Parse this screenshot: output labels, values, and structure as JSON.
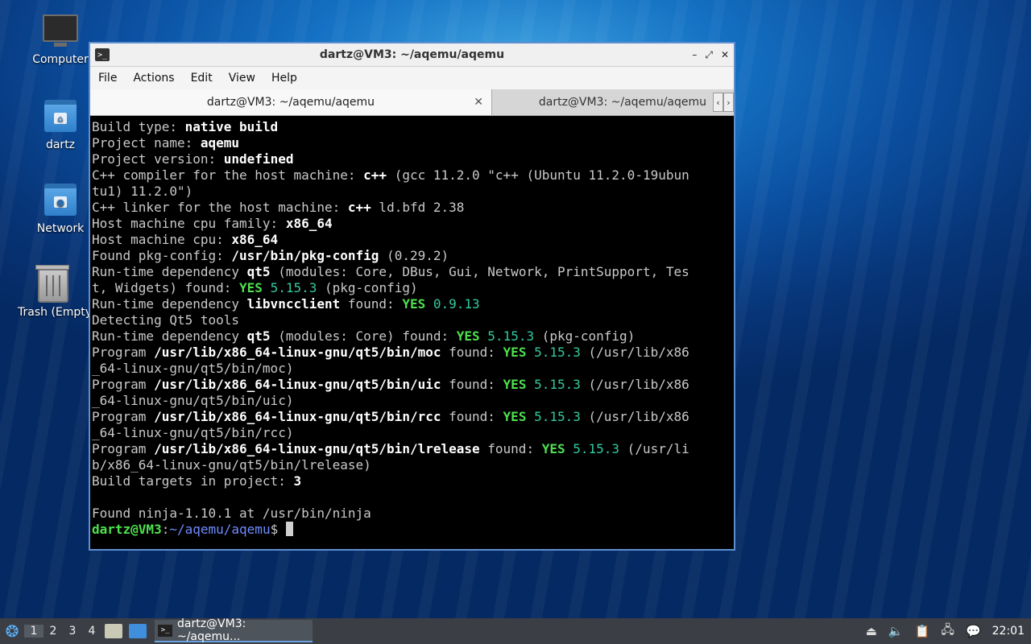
{
  "desktop": {
    "icons": [
      {
        "label": "Computer"
      },
      {
        "label": "dartz"
      },
      {
        "label": "Network"
      },
      {
        "label": "Trash (Empty)"
      }
    ]
  },
  "window": {
    "title": "dartz@VM3: ~/aqemu/aqemu",
    "menu": [
      "File",
      "Actions",
      "Edit",
      "View",
      "Help"
    ],
    "tabs": [
      {
        "label": "dartz@VM3: ~/aqemu/aqemu",
        "active": true
      },
      {
        "label": "dartz@VM3: ~/aqemu/aqemu",
        "active": false
      }
    ],
    "controls": {
      "minimize": "–",
      "maximize": "⤢",
      "close": "✕"
    }
  },
  "terminal": {
    "lines": [
      [
        {
          "t": "Build type: "
        },
        {
          "t": "native build",
          "c": "b"
        }
      ],
      [
        {
          "t": "Project name: "
        },
        {
          "t": "aqemu",
          "c": "b"
        }
      ],
      [
        {
          "t": "Project version: "
        },
        {
          "t": "undefined",
          "c": "b"
        }
      ],
      [
        {
          "t": "C++ compiler for the host machine: "
        },
        {
          "t": "c++",
          "c": "b"
        },
        {
          "t": " (gcc 11.2.0 \"c++ (Ubuntu 11.2.0-19ubun"
        }
      ],
      [
        {
          "t": "tu1) 11.2.0\")"
        }
      ],
      [
        {
          "t": "C++ linker for the host machine: "
        },
        {
          "t": "c++",
          "c": "b"
        },
        {
          "t": " ld.bfd 2.38"
        }
      ],
      [
        {
          "t": "Host machine cpu family: "
        },
        {
          "t": "x86_64",
          "c": "b"
        }
      ],
      [
        {
          "t": "Host machine cpu: "
        },
        {
          "t": "x86_64",
          "c": "b"
        }
      ],
      [
        {
          "t": "Found pkg-config: "
        },
        {
          "t": "/usr/bin/pkg-config",
          "c": "b"
        },
        {
          "t": " (0.29.2)"
        }
      ],
      [
        {
          "t": "Run-time dependency "
        },
        {
          "t": "qt5",
          "c": "b"
        },
        {
          "t": " (modules: Core, DBus, Gui, Network, PrintSupport, Tes"
        }
      ],
      [
        {
          "t": "t, Widgets) found: "
        },
        {
          "t": "YES",
          "c": "g"
        },
        {
          "t": " "
        },
        {
          "t": "5.15.3",
          "c": "v"
        },
        {
          "t": " (pkg-config)"
        }
      ],
      [
        {
          "t": "Run-time dependency "
        },
        {
          "t": "libvncclient",
          "c": "b"
        },
        {
          "t": " found: "
        },
        {
          "t": "YES",
          "c": "g"
        },
        {
          "t": " "
        },
        {
          "t": "0.9.13",
          "c": "v"
        }
      ],
      [
        {
          "t": "Detecting Qt5 tools"
        }
      ],
      [
        {
          "t": "Run-time dependency "
        },
        {
          "t": "qt5",
          "c": "b"
        },
        {
          "t": " (modules: Core) found: "
        },
        {
          "t": "YES",
          "c": "g"
        },
        {
          "t": " "
        },
        {
          "t": "5.15.3",
          "c": "v"
        },
        {
          "t": " (pkg-config)"
        }
      ],
      [
        {
          "t": "Program "
        },
        {
          "t": "/usr/lib/x86_64-linux-gnu/qt5/bin/moc",
          "c": "b"
        },
        {
          "t": " found: "
        },
        {
          "t": "YES",
          "c": "g"
        },
        {
          "t": " "
        },
        {
          "t": "5.15.3",
          "c": "v"
        },
        {
          "t": " (/usr/lib/x86"
        }
      ],
      [
        {
          "t": "_64-linux-gnu/qt5/bin/moc)"
        }
      ],
      [
        {
          "t": "Program "
        },
        {
          "t": "/usr/lib/x86_64-linux-gnu/qt5/bin/uic",
          "c": "b"
        },
        {
          "t": " found: "
        },
        {
          "t": "YES",
          "c": "g"
        },
        {
          "t": " "
        },
        {
          "t": "5.15.3",
          "c": "v"
        },
        {
          "t": " (/usr/lib/x86"
        }
      ],
      [
        {
          "t": "_64-linux-gnu/qt5/bin/uic)"
        }
      ],
      [
        {
          "t": "Program "
        },
        {
          "t": "/usr/lib/x86_64-linux-gnu/qt5/bin/rcc",
          "c": "b"
        },
        {
          "t": " found: "
        },
        {
          "t": "YES",
          "c": "g"
        },
        {
          "t": " "
        },
        {
          "t": "5.15.3",
          "c": "v"
        },
        {
          "t": " (/usr/lib/x86"
        }
      ],
      [
        {
          "t": "_64-linux-gnu/qt5/bin/rcc)"
        }
      ],
      [
        {
          "t": "Program "
        },
        {
          "t": "/usr/lib/x86_64-linux-gnu/qt5/bin/lrelease",
          "c": "b"
        },
        {
          "t": " found: "
        },
        {
          "t": "YES",
          "c": "g"
        },
        {
          "t": " "
        },
        {
          "t": "5.15.3",
          "c": "v"
        },
        {
          "t": " (/usr/li"
        }
      ],
      [
        {
          "t": "b/x86_64-linux-gnu/qt5/bin/lrelease)"
        }
      ],
      [
        {
          "t": "Build targets in project: "
        },
        {
          "t": "3",
          "c": "b"
        }
      ],
      [
        {
          "t": ""
        }
      ],
      [
        {
          "t": "Found ninja-1.10.1 at /usr/bin/ninja"
        }
      ]
    ],
    "prompt": {
      "user": "dartz@VM3",
      "sep": ":",
      "path": "~/aqemu/aqemu",
      "symbol": "$ "
    }
  },
  "taskbar": {
    "workspaces": [
      "1",
      "2",
      "3",
      "4"
    ],
    "active_workspace": "1",
    "task_label": "dartz@VM3: ~/aqemu...",
    "clock": "22:01"
  }
}
